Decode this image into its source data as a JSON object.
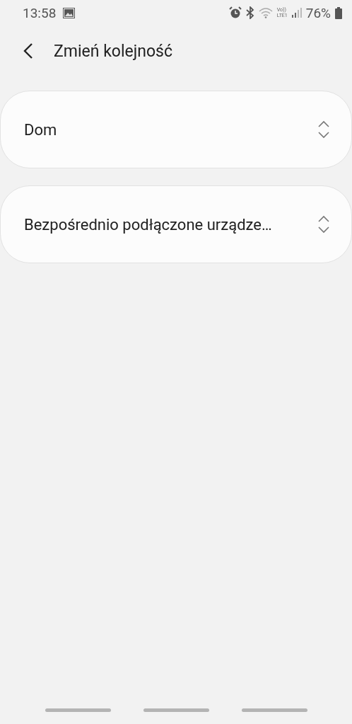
{
  "status_bar": {
    "time": "13:58",
    "volte": "Vo))",
    "network": "LTE1",
    "battery": "76%"
  },
  "header": {
    "title": "Zmień kolejność"
  },
  "items": [
    {
      "label": "Dom"
    },
    {
      "label": "Bezpośrednio podłączone urządze…"
    }
  ]
}
